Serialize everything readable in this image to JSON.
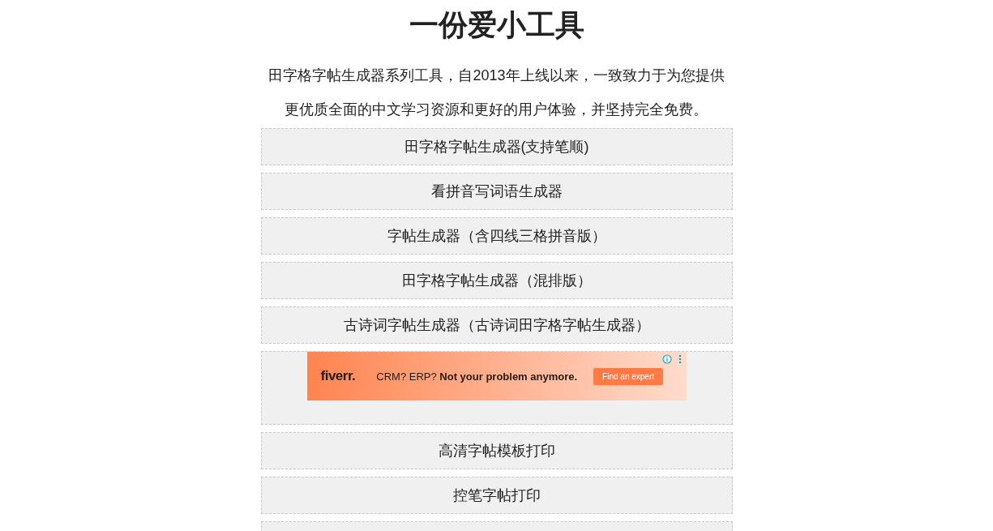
{
  "title": "一份爱小工具",
  "intro": [
    "田字格字帖生成器系列工具，自2013年上线以来，一致致力于为您提供",
    "更优质全面的中文学习资源和更好的用户体验，并坚持完全免费。"
  ],
  "links_top": [
    "田字格字帖生成器(支持笔顺)",
    "看拼音写词语生成器",
    "字帖生成器（含四线三格拼音版）",
    "田字格字帖生成器（混排版）",
    "古诗词字帖生成器（古诗词田字格字帖生成器）"
  ],
  "ad": {
    "brand": "fiverr.",
    "text_plain": "CRM? ERP?",
    "text_bold": "Not your problem anymore.",
    "button": "Find an expert"
  },
  "links_bottom": [
    "高清字帖模板打印",
    "控笔字帖打印"
  ]
}
